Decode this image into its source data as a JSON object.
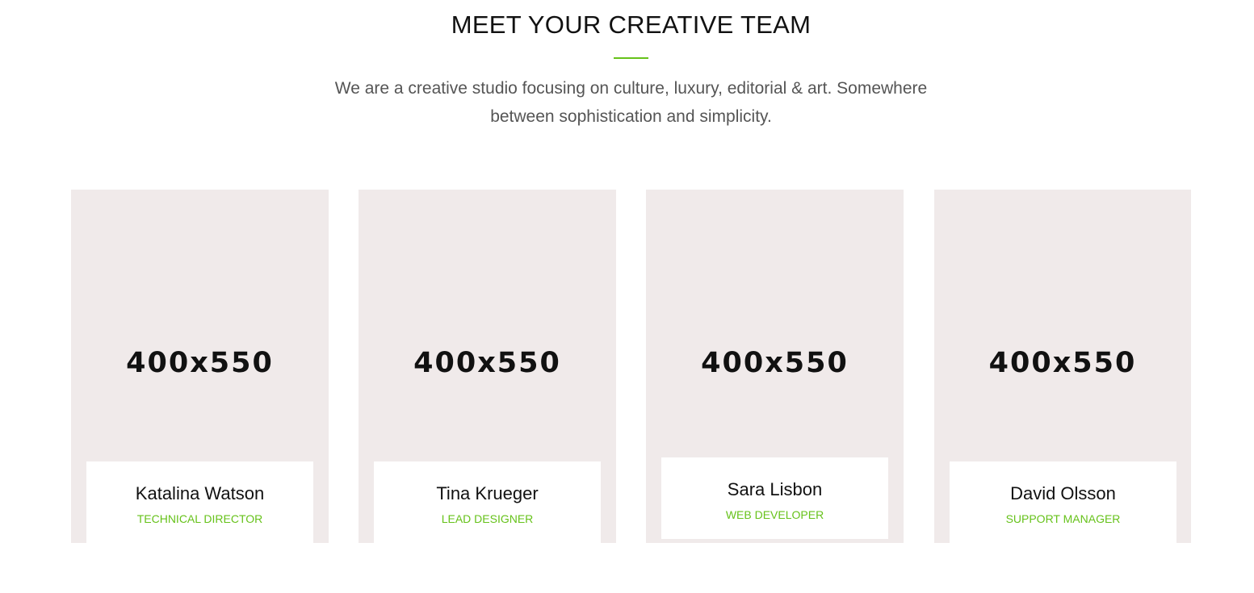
{
  "header": {
    "title": "MEET YOUR CREATIVE TEAM",
    "subtitle": "We are a creative studio focusing on culture, luxury, editorial & art. Somewhere between sophistication and simplicity.",
    "accent_color": "#66c21a"
  },
  "team": [
    {
      "placeholder": "400x550",
      "name": "Katalina Watson",
      "role": "TECHNICAL DIRECTOR"
    },
    {
      "placeholder": "400x550",
      "name": "Tina Krueger",
      "role": "LEAD DESIGNER"
    },
    {
      "placeholder": "400x550",
      "name": "Sara Lisbon",
      "role": "WEB DEVELOPER"
    },
    {
      "placeholder": "400x550",
      "name": "David Olsson",
      "role": "SUPPORT MANAGER"
    }
  ]
}
